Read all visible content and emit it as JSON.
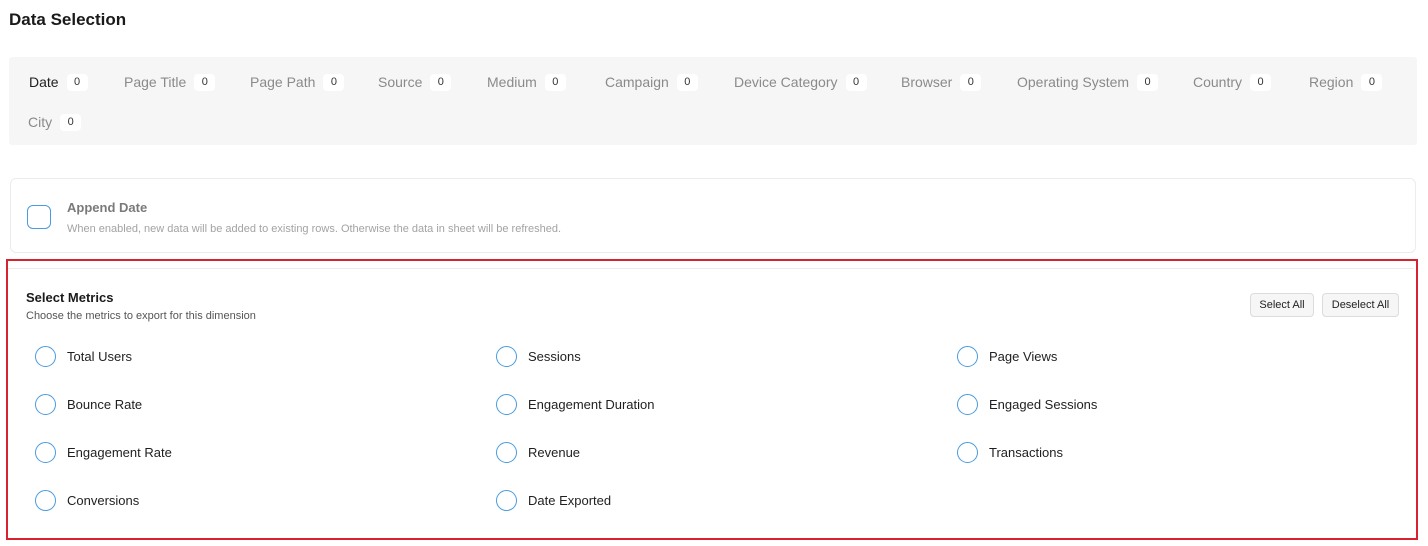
{
  "page": {
    "title": "Data Selection"
  },
  "dimensions": {
    "tabs": [
      {
        "label": "Date",
        "count": "0",
        "active": true
      },
      {
        "label": "Page Title",
        "count": "0"
      },
      {
        "label": "Page Path",
        "count": "0"
      },
      {
        "label": "Source",
        "count": "0"
      },
      {
        "label": "Medium",
        "count": "0"
      },
      {
        "label": "Campaign",
        "count": "0"
      },
      {
        "label": "Device Category",
        "count": "0"
      },
      {
        "label": "Browser",
        "count": "0"
      },
      {
        "label": "Operating System",
        "count": "0"
      },
      {
        "label": "Country",
        "count": "0"
      },
      {
        "label": "Region",
        "count": "0"
      },
      {
        "label": "City",
        "count": "0"
      }
    ]
  },
  "append": {
    "title": "Append Date",
    "description": "When enabled, new data will be added to existing rows. Otherwise the data in sheet will be refreshed.",
    "checked": false
  },
  "metrics": {
    "title": "Select Metrics",
    "subtitle": "Choose the metrics to export for this dimension",
    "select_all_label": "Select All",
    "deselect_all_label": "Deselect All",
    "items": [
      {
        "label": "Total Users",
        "checked": false
      },
      {
        "label": "Sessions",
        "checked": false
      },
      {
        "label": "Page Views",
        "checked": false
      },
      {
        "label": "Bounce Rate",
        "checked": false
      },
      {
        "label": "Engagement Duration",
        "checked": false
      },
      {
        "label": "Engaged Sessions",
        "checked": false
      },
      {
        "label": "Engagement Rate",
        "checked": false
      },
      {
        "label": "Revenue",
        "checked": false
      },
      {
        "label": "Transactions",
        "checked": false
      },
      {
        "label": "Conversions",
        "checked": false
      },
      {
        "label": "Date Exported",
        "checked": false
      }
    ]
  },
  "colors": {
    "checkbox_border": "#4a9be0",
    "highlight_border": "#d8222f",
    "panel_background": "#f6f6f6"
  }
}
